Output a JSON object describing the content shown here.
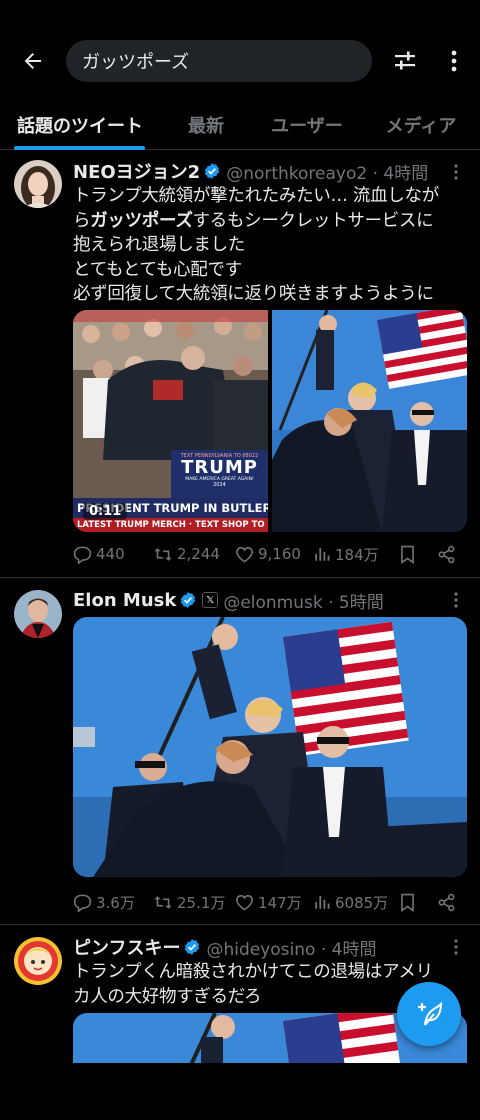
{
  "search": {
    "query": "ガッツポーズ"
  },
  "tabs": [
    {
      "label": "話題のツイート"
    },
    {
      "label": "最新"
    },
    {
      "label": "ユーザー"
    },
    {
      "label": "メディア"
    }
  ],
  "tweets": [
    {
      "name": "NEOヨジョン2",
      "handle": "@northkoreayo2 · 4時間",
      "text_lines": [
        "トランプ大統領が撃たれたみたい… 流血しなが",
        "ら",
        "ガッツポーズ",
        "するもシークレットサービスに",
        "抱えられ退場しました",
        "とてもとても心配です",
        "必ず回復して大統領に返り咲きますようように"
      ],
      "video_time": "0:11",
      "video_banner": {
        "sign_small": "TEXT PENNSYLVANIA TO 88022",
        "sign_big": "TRUMP",
        "sign_sub": "MAKE AMERICA GREAT AGAIN!",
        "sign_year": "2024",
        "banner1": "PRESIDENT TRUMP IN BUTLER",
        "banner2": "LATEST TRUMP MERCH · TEXT SHOP TO"
      },
      "stats": {
        "replies": "440",
        "retweets": "2,244",
        "likes": "9,160",
        "views": "184万"
      }
    },
    {
      "name": "Elon Musk",
      "handle": "@elonmusk · 5時間",
      "affiliate_badge": "𝕏",
      "stats": {
        "replies": "3.6万",
        "retweets": "25.1万",
        "likes": "147万",
        "views": "6085万"
      }
    },
    {
      "name": "ピンフスキー",
      "handle": "@hideyosino · 4時間",
      "text_lines": [
        "トランプくん暗殺されかけてこの退場はアメリ",
        "カ人の大好物すぎるだろ"
      ]
    }
  ],
  "colors": {
    "accent": "#1d9bf0",
    "muted": "#71767b",
    "background": "#000000"
  },
  "icons": [
    "back-arrow-icon",
    "filter-icon",
    "more-vertical-icon",
    "verified-badge-icon",
    "reply-icon",
    "retweet-icon",
    "like-icon",
    "views-icon",
    "bookmark-icon",
    "share-icon",
    "compose-icon"
  ]
}
